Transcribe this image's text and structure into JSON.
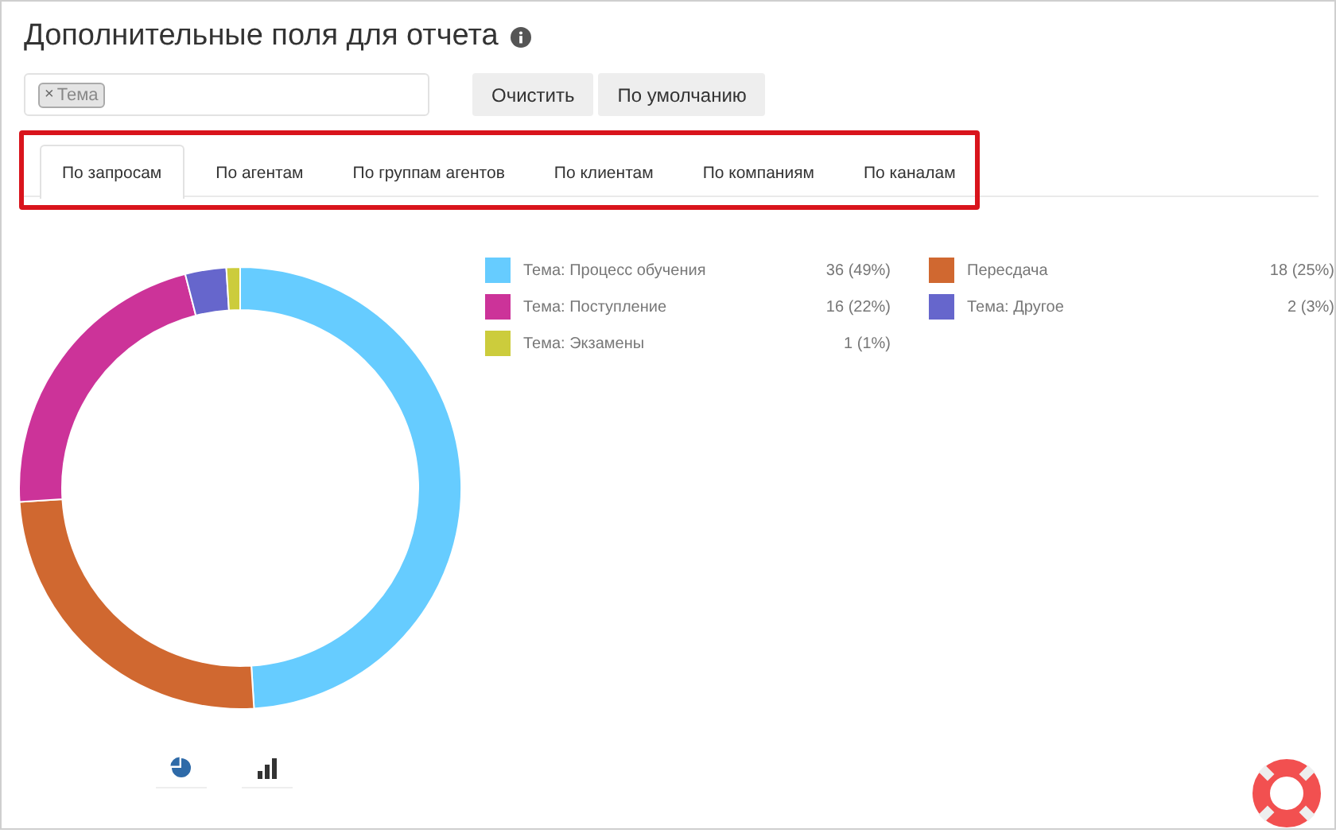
{
  "header": {
    "title": "Дополнительные поля для отчета"
  },
  "fields": {
    "tags": [
      {
        "remove": "×",
        "label": "Тема"
      }
    ],
    "buttons": [
      "Очистить",
      "По умолчанию"
    ]
  },
  "tabs": [
    {
      "label": "По запросам",
      "selected": true
    },
    {
      "label": "По агентам",
      "selected": false
    },
    {
      "label": "По группам агентов",
      "selected": false
    },
    {
      "label": "По клиентам",
      "selected": false
    },
    {
      "label": "По компаниям",
      "selected": false
    },
    {
      "label": "По каналам",
      "selected": false
    }
  ],
  "chart": {
    "chart_data": {
      "type": "donut",
      "categories": [
        "Тема: Процесс обучения",
        "Пересдача",
        "Тема: Поступление",
        "Тема: Другое",
        "Тема: Экзамены"
      ],
      "series": [
        {
          "values": [
            49,
            25,
            22,
            3,
            1
          ]
        }
      ]
    },
    "legend": [
      {
        "value": "36 (49%)",
        "color": "#66ccff"
      },
      {
        "value": "18 (25%)",
        "color": "#d06830"
      },
      {
        "value": "16 (22%)",
        "color": "#cc3399"
      },
      {
        "value": "2 (3%)",
        "color": "#6666cc"
      },
      {
        "value": "1 (1%)",
        "color": "#cccc3c"
      }
    ],
    "chart_types": [
      {
        "kind": "pie",
        "selected": true
      },
      {
        "kind": "bar",
        "selected": false
      }
    ]
  }
}
